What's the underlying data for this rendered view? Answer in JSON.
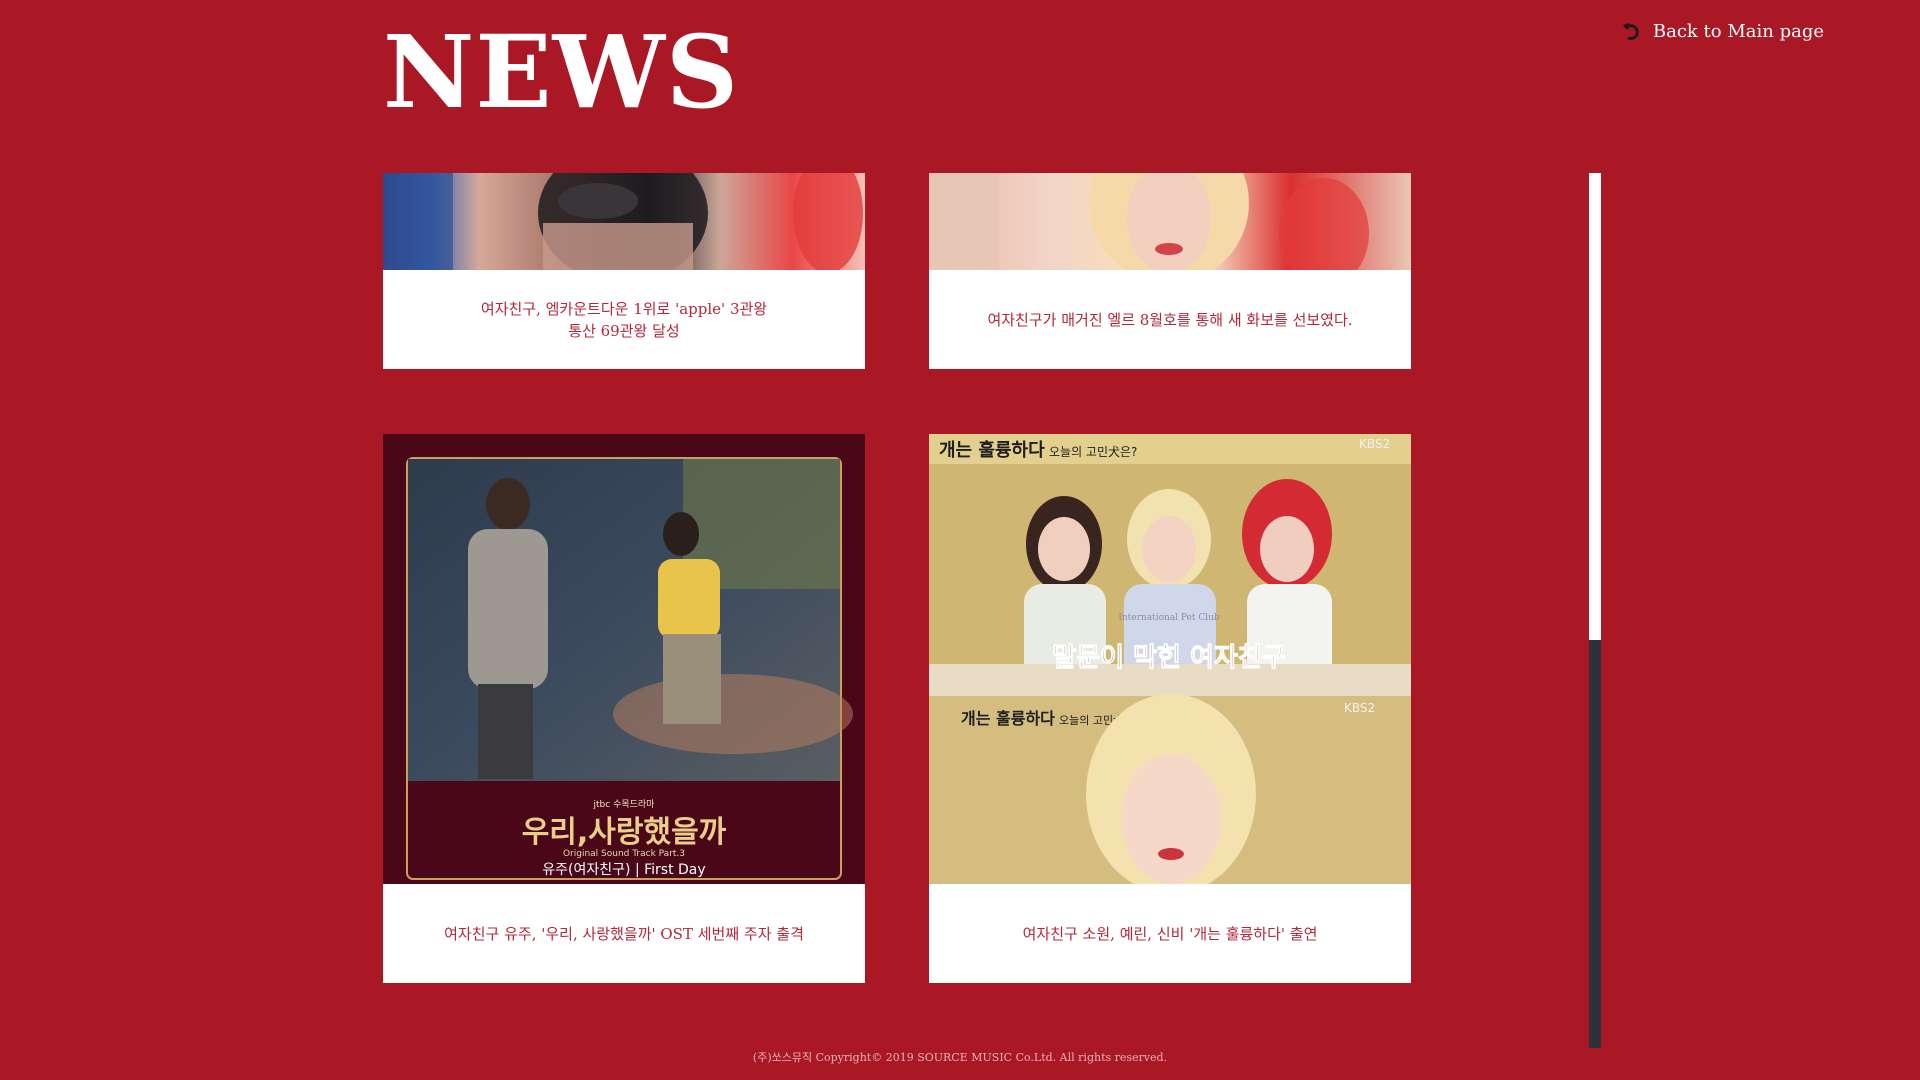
{
  "page": {
    "title": "NEWS",
    "back_label": "Back to Main page",
    "footer": "(주)쏘스뮤직 Copyright© 2019 SOURCE MUSIC Co.Ltd. All rights reserved."
  },
  "news": [
    {
      "caption": "여자친구, 엠카운트다운 1위로 'apple' 3관왕\n통산 69관왕 달성"
    },
    {
      "caption": "여자친구가 매거진 엘르 8월호를 통해 새 화보를 선보였다."
    },
    {
      "caption": "여자친구 유주, '우리, 사랑했을까' OST 세번째 주자 출격",
      "poster": {
        "brand": "jtbc 수목드라마",
        "title": "우리,사랑했을까",
        "subtitle": "Original Sound Track Part.3",
        "artist": "유주(여자친구)  |  First Day"
      }
    },
    {
      "caption": "여자친구 소원, 예린, 신비 '개는 훌륭하다' 출연",
      "screen": {
        "show": "개는 훌륭하다",
        "tag": "오늘의 고민犬은?",
        "channel": "KBS2",
        "subtitle_a": "말문이 막힌 ",
        "subtitle_b": "여자친구",
        "shirt": "International Pet Club"
      }
    }
  ]
}
